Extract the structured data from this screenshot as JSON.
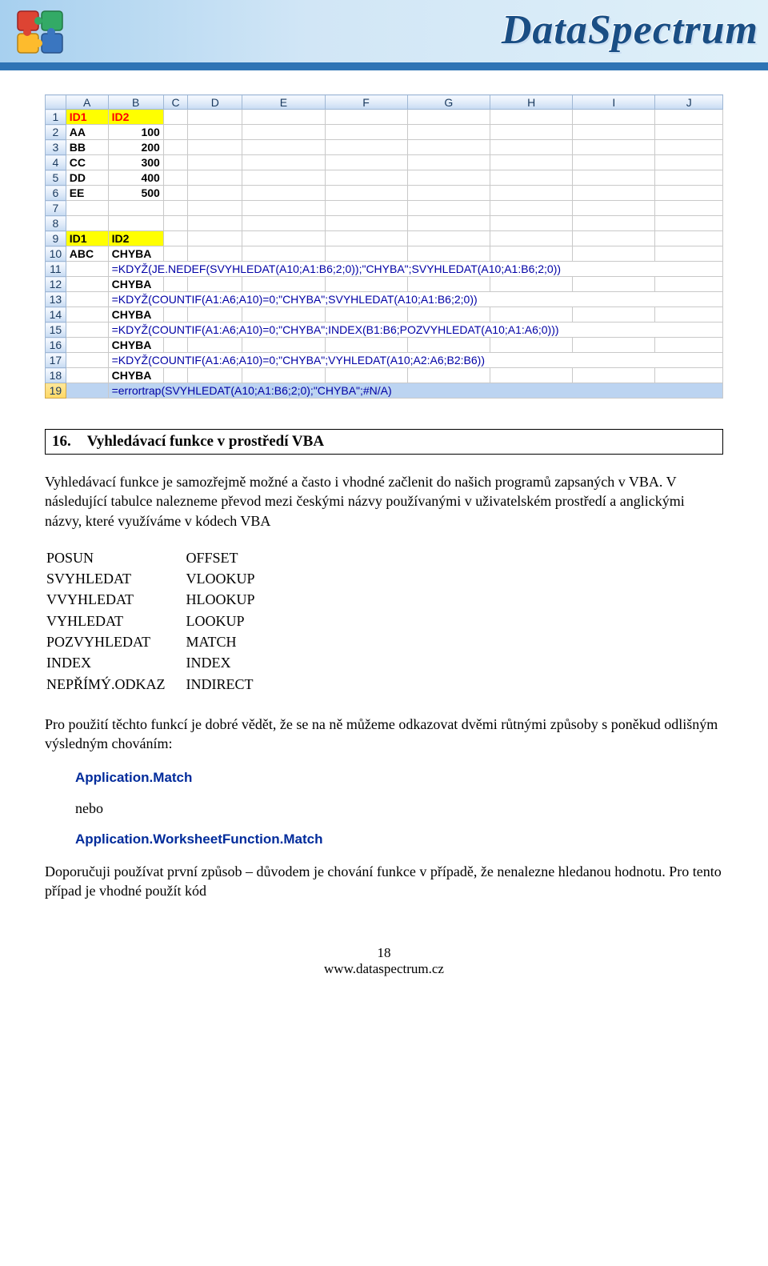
{
  "header": {
    "brand": "DataSpectrum"
  },
  "ss": {
    "cols": [
      "A",
      "B",
      "C",
      "D",
      "E",
      "F",
      "G",
      "H",
      "I",
      "J"
    ],
    "rows": [
      {
        "r": "1",
        "A": "ID1",
        "B": "ID2",
        "ay": true,
        "by": true,
        "ar": true,
        "br": true
      },
      {
        "r": "2",
        "A": "AA",
        "B": "100",
        "ab": true,
        "bn": true
      },
      {
        "r": "3",
        "A": "BB",
        "B": "200",
        "ab": true,
        "bn": true
      },
      {
        "r": "4",
        "A": "CC",
        "B": "300",
        "ab": true,
        "bn": true
      },
      {
        "r": "5",
        "A": "DD",
        "B": "400",
        "ab": true,
        "bn": true
      },
      {
        "r": "6",
        "A": "EE",
        "B": "500",
        "ab": true,
        "bn": true
      },
      {
        "r": "7"
      },
      {
        "r": "8"
      },
      {
        "r": "9",
        "A": "ID1",
        "B": "ID2",
        "ay": true,
        "by": true,
        "ab2": true,
        "bb2": true
      },
      {
        "r": "10",
        "A": "ABC",
        "B": "CHYBA",
        "ab": true,
        "bb2": true
      },
      {
        "r": "11",
        "formula": "=KDYŽ(JE.NEDEF(SVYHLEDAT(A10;A1:B6;2;0));\"CHYBA\";SVYHLEDAT(A10;A1:B6;2;0))"
      },
      {
        "r": "12",
        "B": "CHYBA",
        "bb2": true
      },
      {
        "r": "13",
        "formula": "=KDYŽ(COUNTIF(A1:A6;A10)=0;\"CHYBA\";SVYHLEDAT(A10;A1:B6;2;0))"
      },
      {
        "r": "14",
        "B": "CHYBA",
        "bb2": true
      },
      {
        "r": "15",
        "formula": "=KDYŽ(COUNTIF(A1:A6;A10)=0;\"CHYBA\";INDEX(B1:B6;POZVYHLEDAT(A10;A1:A6;0)))"
      },
      {
        "r": "16",
        "B": "CHYBA",
        "bb2": true
      },
      {
        "r": "17",
        "formula": "=KDYŽ(COUNTIF(A1:A6;A10)=0;\"CHYBA\";VYHLEDAT(A10;A2:A6;B2:B6))"
      },
      {
        "r": "18",
        "B": "CHYBA",
        "bb2": true
      },
      {
        "r": "19",
        "formula": "=errortrap(SVYHLEDAT(A10;A1:B6;2;0);\"CHYBA\";#N/A)",
        "sel": true
      }
    ]
  },
  "section": {
    "num": "16.",
    "title": "Vyhledávací funkce v prostředí VBA"
  },
  "p1": "Vyhledávací funkce je samozřejmě možné a často i vhodné začlenit do našich programů zapsaných v VBA. V následující tabulce nalezneme převod mezi českými názvy používanými v uživatelském prostředí a anglickými názvy, které využíváme v kódech VBA",
  "fnmap": [
    [
      "POSUN",
      "OFFSET"
    ],
    [
      "SVYHLEDAT",
      "VLOOKUP"
    ],
    [
      "VVYHLEDAT",
      "HLOOKUP"
    ],
    [
      "VYHLEDAT",
      "LOOKUP"
    ],
    [
      "POZVYHLEDAT",
      "MATCH"
    ],
    [
      "INDEX",
      "INDEX"
    ],
    [
      "NEPŘÍMÝ.ODKAZ",
      "INDIRECT"
    ]
  ],
  "p2": "Pro použití těchto funkcí je dobré vědět, že se na ně můžeme odkazovat dvěmi růtnými způsoby s poněkud odlišným výsledným chováním:",
  "code1": "Application.Match",
  "or": "nebo",
  "code2": "Application.WorksheetFunction.Match",
  "p3": "Doporučuji používat první způsob – důvodem je chování funkce v případě, že nenalezne hledanou hodnotu. Pro tento případ je vhodné použít kód",
  "footer": {
    "page": "18",
    "url": "www.dataspectrum.cz"
  }
}
